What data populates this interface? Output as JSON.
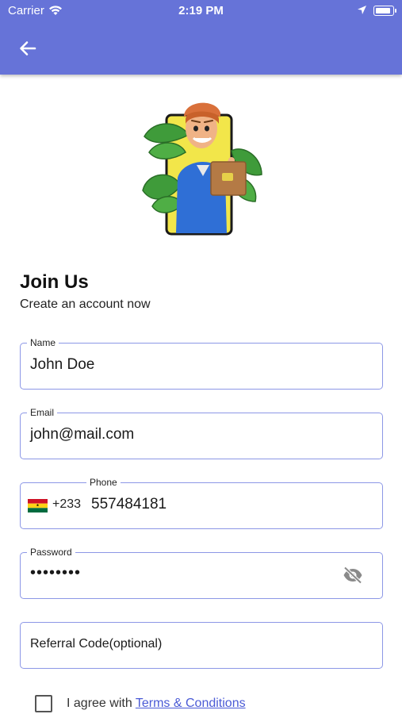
{
  "status_bar": {
    "carrier": "Carrier",
    "time": "2:19 PM",
    "battery_level": 0.9
  },
  "header": {
    "back_icon": "arrow-left-icon",
    "bg_color": "#6673d8"
  },
  "hero": {
    "icon": "delivery-man-illustration"
  },
  "form": {
    "title": "Join Us",
    "subtitle": "Create an account now",
    "name": {
      "label": "Name",
      "value": "John Doe"
    },
    "email": {
      "label": "Email",
      "value": "john@mail.com"
    },
    "phone": {
      "label": "Phone",
      "country_code": "+233",
      "value": "557484181",
      "flag_icon": "ghana-flag-icon"
    },
    "password": {
      "label": "Password",
      "value": "••••••••",
      "toggle_icon": "eye-off-icon"
    },
    "referral": {
      "placeholder": "Referral Code(optional)"
    },
    "agreement": {
      "text": "I agree with",
      "link_text": "Terms & Conditions",
      "checked": false
    }
  },
  "colors": {
    "accent": "#6673d8",
    "border": "#8c97e6",
    "link": "#4b5bd6"
  }
}
